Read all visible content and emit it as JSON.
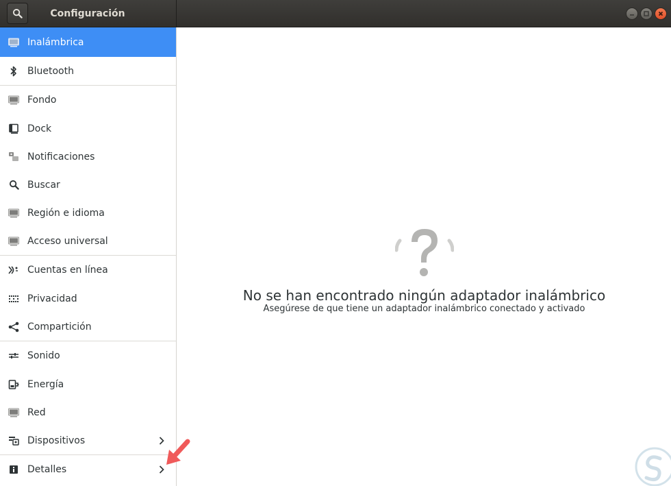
{
  "titlebar": {
    "title": "Configuración",
    "search_icon": "search-icon",
    "window_buttons": [
      "minimize",
      "maximize",
      "close"
    ],
    "close_color": "#e9572f"
  },
  "sidebar": {
    "accent": "#3e8ef5",
    "items": [
      {
        "label": "Inalámbrica",
        "icon": "wireless-icon",
        "selected": true
      },
      {
        "label": "Bluetooth",
        "icon": "bluetooth-icon"
      },
      {
        "label": "Fondo",
        "icon": "background-icon"
      },
      {
        "label": "Dock",
        "icon": "dock-icon"
      },
      {
        "label": "Notificaciones",
        "icon": "notifications-icon"
      },
      {
        "label": "Buscar",
        "icon": "search-icon"
      },
      {
        "label": "Región e idioma",
        "icon": "region-icon"
      },
      {
        "label": "Acceso universal",
        "icon": "accessibility-icon"
      },
      {
        "label": "Cuentas en línea",
        "icon": "online-accounts-icon"
      },
      {
        "label": "Privacidad",
        "icon": "privacy-icon"
      },
      {
        "label": "Compartición",
        "icon": "share-icon"
      },
      {
        "label": "Sonido",
        "icon": "sound-icon"
      },
      {
        "label": "Energía",
        "icon": "power-icon"
      },
      {
        "label": "Red",
        "icon": "network-icon"
      },
      {
        "label": "Dispositivos",
        "icon": "devices-icon",
        "chevron": true
      },
      {
        "label": "Detalles",
        "icon": "details-icon",
        "chevron": true
      }
    ]
  },
  "main": {
    "empty_icon": "question-mark-icon",
    "empty_title": "No se han encontrado ningún adaptador inalámbrico",
    "empty_subtitle": "Asegúrese de que tiene un adaptador inalámbrico conectado y activado"
  },
  "annotation": {
    "arrow_color": "#f05a5a"
  }
}
